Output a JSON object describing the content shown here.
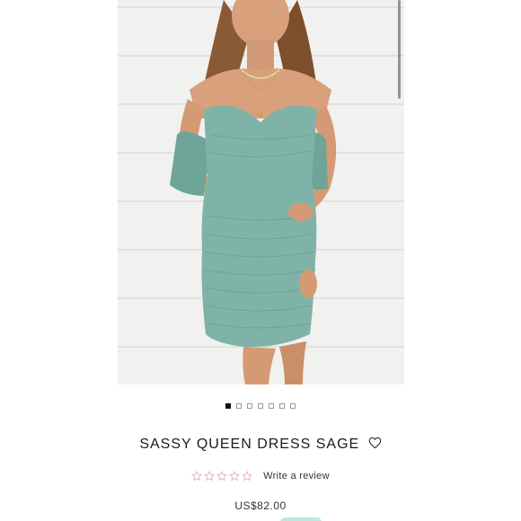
{
  "product": {
    "title": "SASSY QUEEN DRESS SAGE",
    "price": "US$82.00",
    "review_link": "Write a review",
    "rating": 0,
    "rating_max": 5
  },
  "carousel": {
    "slides": 7,
    "active_index": 0
  },
  "icons": {
    "wishlist": "heart-outline-icon",
    "rating_star": "star-outline-icon"
  },
  "colors": {
    "dress": "#7fb3a8",
    "star_outline": "#e0a6b8",
    "accent_pill": "#bfe6e1",
    "active_dot": "#111111"
  }
}
